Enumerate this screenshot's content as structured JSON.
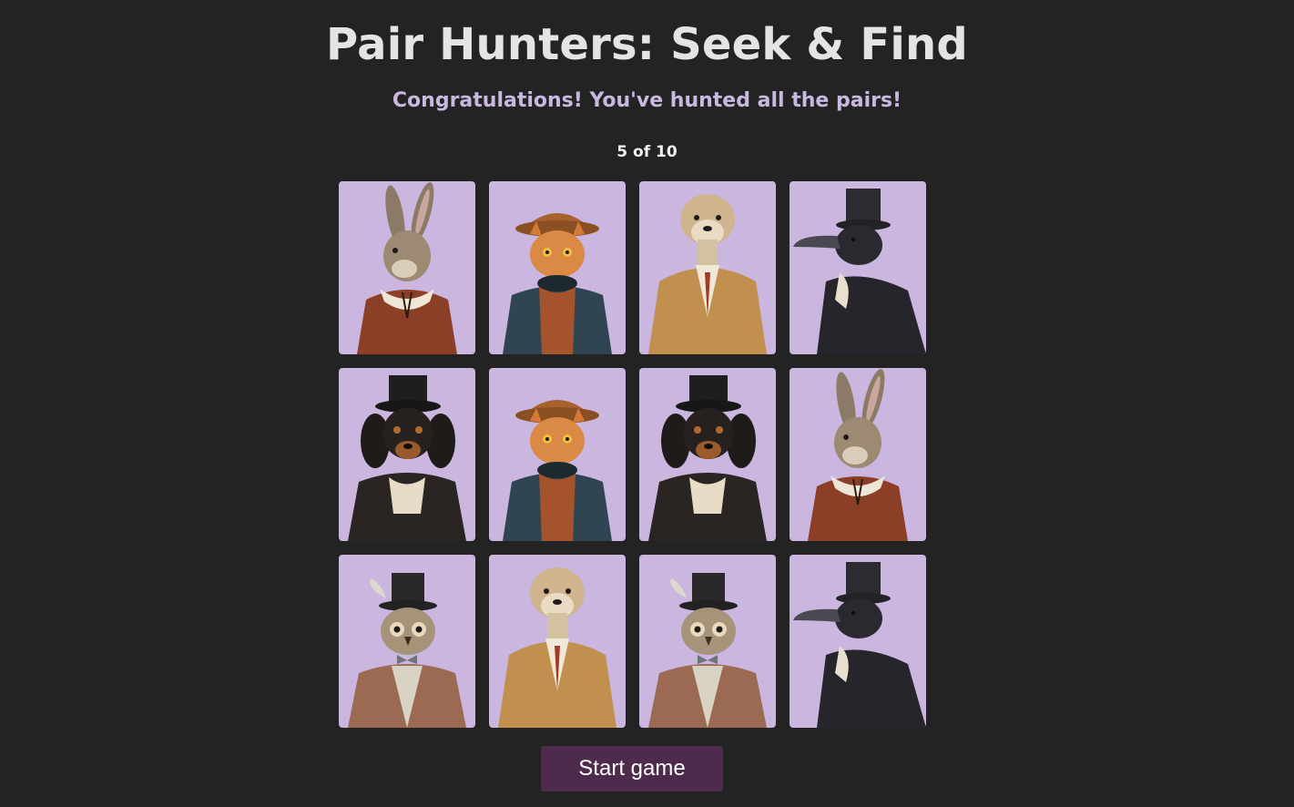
{
  "header": {
    "title": "Pair Hunters: Seek & Find",
    "message": "Congratulations! You've hunted all the pairs!",
    "counter": "5 of 10"
  },
  "cards": [
    {
      "animal": "rabbit",
      "icon": "rabbit-portrait-icon"
    },
    {
      "animal": "cat",
      "icon": "cat-portrait-icon"
    },
    {
      "animal": "otter",
      "icon": "otter-portrait-icon"
    },
    {
      "animal": "crow",
      "icon": "crow-portrait-icon"
    },
    {
      "animal": "dog",
      "icon": "dog-portrait-icon"
    },
    {
      "animal": "cat",
      "icon": "cat-portrait-icon"
    },
    {
      "animal": "dog",
      "icon": "dog-portrait-icon"
    },
    {
      "animal": "rabbit",
      "icon": "rabbit-portrait-icon"
    },
    {
      "animal": "owl",
      "icon": "owl-portrait-icon"
    },
    {
      "animal": "otter",
      "icon": "otter-portrait-icon"
    },
    {
      "animal": "owl",
      "icon": "owl-portrait-icon"
    },
    {
      "animal": "crow",
      "icon": "crow-portrait-icon"
    }
  ],
  "controls": {
    "start_label": "Start game"
  },
  "colors": {
    "background": "#232323",
    "card": "#cab6df",
    "accent_text": "#c9b8e0",
    "button": "#4e2a4c"
  }
}
